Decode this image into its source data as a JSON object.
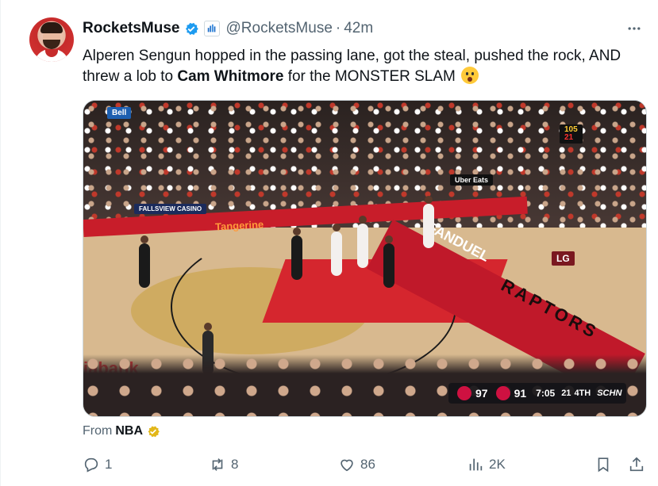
{
  "tweet": {
    "display_name": "RocketsMuse",
    "handle": "@RocketsMuse",
    "separator": "·",
    "time": "42m",
    "text_part1": "Alperen Sengun hopped in the passing lane, got the steal, pushed the rock, AND threw a lob to ",
    "text_bold": "Cam Whitmore",
    "text_part2": " for the MONSTER SLAM",
    "from_label": "From",
    "from_name": "NBA"
  },
  "media": {
    "signs": {
      "bell": "Bell",
      "fallsview": "FALLSVIEW CASINO",
      "ubereats": "Uber Eats",
      "tangerine": "Tangerine",
      "fanduel": "FANDUEL",
      "raptors": "RAPTORS",
      "court_ad": "iabank",
      "lg": "LG",
      "shot_clock": "105",
      "shot_clock_2": "21"
    },
    "scorebug": {
      "home_score": "97",
      "away_score": "91",
      "game_clock": "7:05",
      "shot_clock": "21",
      "quarter": "4TH",
      "network": "SCHN"
    }
  },
  "actions": {
    "reply_count": "1",
    "repost_count": "8",
    "like_count": "86",
    "views_count": "2K"
  },
  "icons": {
    "verified": "verified-badge-icon",
    "affiliate": "affiliate-badge-icon",
    "more": "more-icon",
    "reply": "reply-icon",
    "repost": "repost-icon",
    "like": "heart-icon",
    "views": "views-icon",
    "bookmark": "bookmark-icon",
    "share": "share-icon",
    "gold_verified": "gold-verified-icon",
    "emoji": "astonished-face-emoji"
  },
  "colors": {
    "verified_blue": "#1d9bf0",
    "secondary_text": "#536471",
    "gold_badge": "#e2b719",
    "raptors_red": "#ce1141",
    "rockets_red": "#ce1141"
  }
}
